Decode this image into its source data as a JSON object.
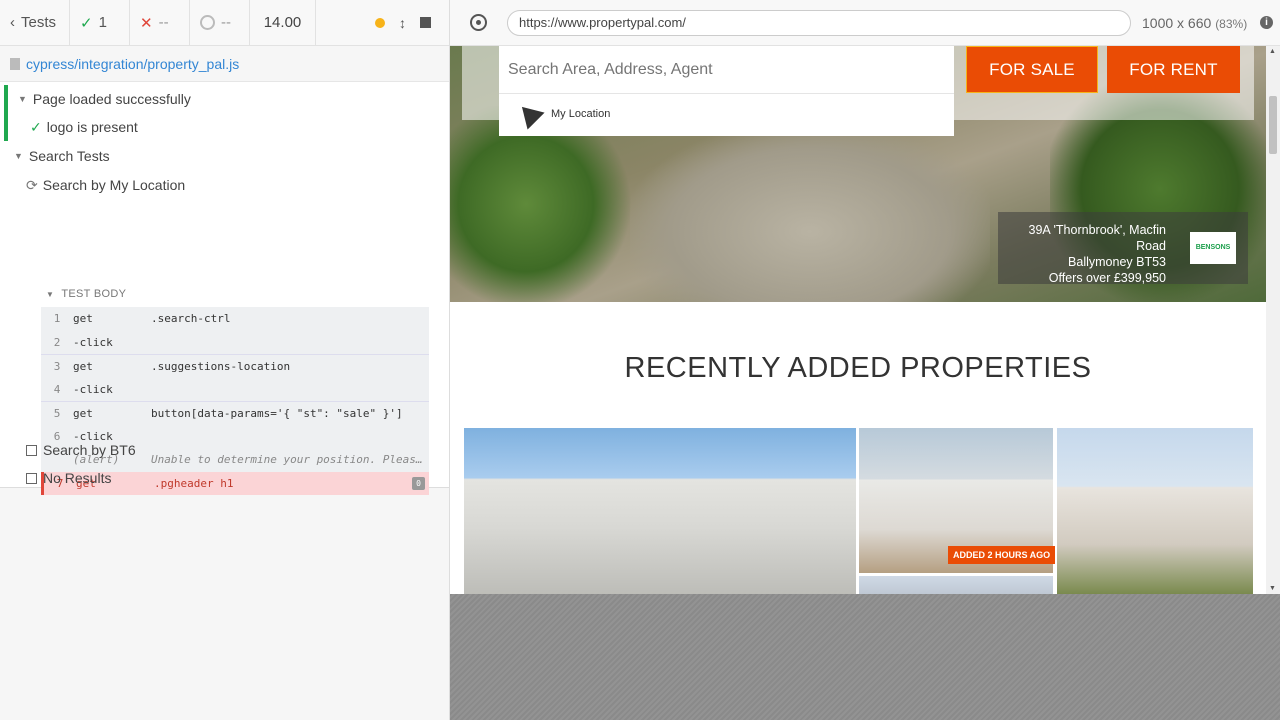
{
  "runner": {
    "back_label": "Tests",
    "passed": "1",
    "failed": "--",
    "pending": "--",
    "duration": "14.00",
    "spec_file": "cypress/integration/property_pal.js"
  },
  "tests": {
    "suite1": "Page loaded successfully",
    "suite1_test": "logo is present",
    "suite2": "Search Tests",
    "running_test": "Search by My Location",
    "test_body_label": "TEST BODY",
    "pending1": "Search by BT6",
    "pending2": "No Results"
  },
  "commands": [
    {
      "num": "1",
      "name": "get",
      "msg": ".search-ctrl"
    },
    {
      "num": "2",
      "name": "-click",
      "msg": ""
    },
    {
      "num": "3",
      "name": "get",
      "msg": ".suggestions-location"
    },
    {
      "num": "4",
      "name": "-click",
      "msg": ""
    },
    {
      "num": "5",
      "name": "get",
      "msg": "button[data-params='{ \"st\": \"sale\" }']"
    },
    {
      "num": "6",
      "name": "-click",
      "msg": ""
    },
    {
      "num": "",
      "name": "(alert)",
      "msg": "Unable to determine your position. Pleas…"
    },
    {
      "num": "7",
      "name": "get",
      "msg": ".pgheader h1",
      "badge": "0"
    }
  ],
  "browser": {
    "url": "https://www.propertypal.com/",
    "viewport_size": "1000 x 660",
    "zoom": "(83%)"
  },
  "site": {
    "search_placeholder": "Search Area, Address, Agent",
    "my_location": "My Location",
    "for_sale": "FOR SALE",
    "for_rent": "FOR RENT",
    "caption_line1": "39A 'Thornbrook', Macfin Road",
    "caption_line2": "Ballymoney BT53",
    "caption_line3": "Offers over £399,950",
    "agent_logo": "BENSONS",
    "recent_heading": "RECENTLY ADDED PROPERTIES",
    "added_badge": "ADDED 2 HOURS AGO"
  },
  "colors": {
    "accent": "#ea4c05",
    "pass": "#1fa84f",
    "fail": "#e0463a",
    "link": "#3386d4"
  }
}
